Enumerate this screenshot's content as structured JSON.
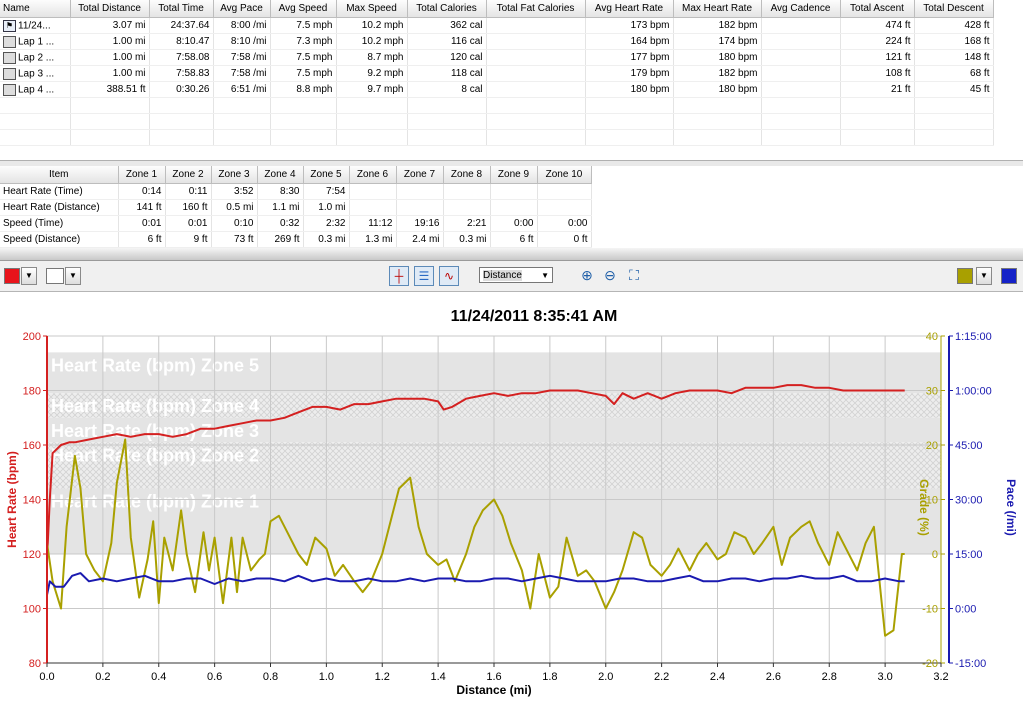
{
  "laps": {
    "columns": [
      "Name",
      "Total Distance",
      "Total Time",
      "Avg Pace",
      "Avg Speed",
      "Max Speed",
      "Total Calories",
      "Total Fat Calories",
      "Avg Heart Rate",
      "Max Heart Rate",
      "Avg Cadence",
      "Total Ascent",
      "Total Descent"
    ],
    "rows": [
      [
        "11/24...",
        "3.07 mi",
        "24:37.64",
        "8:00 /mi",
        "7.5 mph",
        "10.2 mph",
        "362 cal",
        "",
        "173 bpm",
        "182 bpm",
        "",
        "474 ft",
        "428 ft"
      ],
      [
        "Lap 1 ...",
        "1.00 mi",
        "8:10.47",
        "8:10 /mi",
        "7.3 mph",
        "10.2 mph",
        "116 cal",
        "",
        "164 bpm",
        "174 bpm",
        "",
        "224 ft",
        "168 ft"
      ],
      [
        "Lap 2 ...",
        "1.00 mi",
        "7:58.08",
        "7:58 /mi",
        "7.5 mph",
        "8.7 mph",
        "120 cal",
        "",
        "177 bpm",
        "180 bpm",
        "",
        "121 ft",
        "148 ft"
      ],
      [
        "Lap 3 ...",
        "1.00 mi",
        "7:58.83",
        "7:58 /mi",
        "7.5 mph",
        "9.2 mph",
        "118 cal",
        "",
        "179 bpm",
        "182 bpm",
        "",
        "108 ft",
        "68 ft"
      ],
      [
        "Lap 4 ...",
        "388.51 ft",
        "0:30.26",
        "6:51 /mi",
        "8.8 mph",
        "9.7 mph",
        "8 cal",
        "",
        "180 bpm",
        "180 bpm",
        "",
        "21 ft",
        "45 ft"
      ]
    ]
  },
  "zones": {
    "columns": [
      "Item",
      "Zone 1",
      "Zone 2",
      "Zone 3",
      "Zone 4",
      "Zone 5",
      "Zone 6",
      "Zone 7",
      "Zone 8",
      "Zone 9",
      "Zone 10"
    ],
    "rows": [
      [
        "Heart Rate (Time)",
        "0:14",
        "0:11",
        "3:52",
        "8:30",
        "7:54",
        "",
        "",
        "",
        "",
        ""
      ],
      [
        "Heart Rate (Distance)",
        "141 ft",
        "160 ft",
        "0.5 mi",
        "1.1 mi",
        "1.0 mi",
        "",
        "",
        "",
        "",
        ""
      ],
      [
        "Speed (Time)",
        "0:01",
        "0:01",
        "0:10",
        "0:32",
        "2:32",
        "11:12",
        "19:16",
        "2:21",
        "0:00",
        "0:00"
      ],
      [
        "Speed (Distance)",
        "6 ft",
        "9 ft",
        "73 ft",
        "269 ft",
        "0.3 mi",
        "1.3 mi",
        "2.4 mi",
        "0.3 mi",
        "6 ft",
        "0 ft"
      ]
    ]
  },
  "toolbar": {
    "left_color": "#e8141b",
    "left_color2": "#ffffff",
    "right_color": "#a9a000",
    "right_color2": "#1522c8",
    "xaxis_value": "Distance",
    "icons": [
      "chart-crosshair-icon",
      "chart-split-icon",
      "chart-wave-icon",
      "zoom-in-icon",
      "zoom-out-icon",
      "zoom-fit-icon"
    ]
  },
  "chart_data": {
    "type": "line",
    "title": "11/24/2011 8:35:41 AM",
    "xlabel": "Distance (mi)",
    "xlim": [
      0,
      3.2
    ],
    "x_ticks": [
      "0.0",
      "0.2",
      "0.4",
      "0.6",
      "0.8",
      "1.0",
      "1.2",
      "1.4",
      "1.6",
      "1.8",
      "2.0",
      "2.2",
      "2.4",
      "2.6",
      "2.8",
      "3.0",
      "3.2"
    ],
    "axes": {
      "left": {
        "label": "Heart Rate (bpm)",
        "ylim": [
          80,
          200
        ],
        "ticks": [
          "80",
          "100",
          "120",
          "140",
          "160",
          "180",
          "200"
        ],
        "color": "#d42020"
      },
      "right1": {
        "label": "Grade (%)",
        "ylim": [
          -20,
          40
        ],
        "ticks": [
          "-20",
          "-10",
          "0",
          "10",
          "20",
          "30",
          "40"
        ],
        "color": "#a9a000"
      },
      "right2": {
        "label": "Pace (/mi)",
        "ticks": [
          "15:00",
          "0:00",
          "15:00",
          "30:00",
          "45:00",
          "1:00:00",
          "1:15:00"
        ],
        "color": "#1a1ab0"
      }
    },
    "zones": [
      {
        "name": "Heart Rate (bpm) Zone 5",
        "range": [
          179,
          194
        ],
        "style": "solid"
      },
      {
        "name": "Heart Rate (bpm) Zone 4",
        "range": [
          170,
          179
        ],
        "style": "hatch"
      },
      {
        "name": "Heart Rate (bpm) Zone 3",
        "range": [
          161,
          170
        ],
        "style": "solid"
      },
      {
        "name": "Heart Rate (bpm) Zone 2",
        "range": [
          144,
          161
        ],
        "style": "hatch"
      },
      {
        "name": "Heart Rate (bpm) Zone 1",
        "range": [
          120,
          144
        ],
        "style": "solid"
      }
    ],
    "series": [
      {
        "name": "Heart Rate (bpm)",
        "axis": "left",
        "color": "#d42020",
        "x": [
          0,
          0.01,
          0.02,
          0.05,
          0.08,
          0.1,
          0.15,
          0.2,
          0.25,
          0.3,
          0.35,
          0.4,
          0.45,
          0.5,
          0.55,
          0.6,
          0.65,
          0.7,
          0.75,
          0.8,
          0.85,
          0.9,
          0.95,
          1.0,
          1.05,
          1.1,
          1.15,
          1.2,
          1.25,
          1.3,
          1.35,
          1.4,
          1.42,
          1.45,
          1.5,
          1.55,
          1.6,
          1.65,
          1.7,
          1.75,
          1.8,
          1.85,
          1.9,
          1.95,
          2.0,
          2.03,
          2.06,
          2.1,
          2.15,
          2.2,
          2.25,
          2.3,
          2.35,
          2.4,
          2.45,
          2.5,
          2.55,
          2.6,
          2.65,
          2.7,
          2.75,
          2.8,
          2.85,
          2.9,
          2.95,
          3.0,
          3.05,
          3.07
        ],
        "y": [
          118,
          140,
          157,
          160,
          161,
          161,
          162,
          163,
          164,
          163,
          164,
          164,
          163,
          164,
          166,
          166,
          167,
          168,
          169,
          169,
          170,
          172,
          174,
          174,
          173,
          175,
          175,
          176,
          177,
          177,
          177,
          176,
          173,
          174,
          177,
          178,
          179,
          178,
          179,
          179,
          180,
          180,
          180,
          179,
          178,
          175,
          179,
          177,
          179,
          177,
          179,
          180,
          180,
          180,
          179,
          181,
          181,
          181,
          182,
          182,
          181,
          181,
          180,
          180,
          180,
          180,
          180,
          180
        ]
      },
      {
        "name": "Grade (%)",
        "axis": "right1",
        "color": "#a9a000",
        "x": [
          0,
          0.02,
          0.05,
          0.07,
          0.1,
          0.12,
          0.14,
          0.17,
          0.2,
          0.23,
          0.25,
          0.28,
          0.3,
          0.33,
          0.36,
          0.38,
          0.4,
          0.42,
          0.45,
          0.48,
          0.5,
          0.53,
          0.56,
          0.58,
          0.6,
          0.63,
          0.66,
          0.68,
          0.7,
          0.73,
          0.76,
          0.78,
          0.8,
          0.83,
          0.86,
          0.9,
          0.93,
          0.96,
          1.0,
          1.03,
          1.06,
          1.1,
          1.13,
          1.16,
          1.2,
          1.23,
          1.26,
          1.3,
          1.33,
          1.36,
          1.4,
          1.43,
          1.46,
          1.5,
          1.53,
          1.56,
          1.6,
          1.63,
          1.66,
          1.7,
          1.73,
          1.76,
          1.8,
          1.83,
          1.86,
          1.9,
          1.93,
          1.96,
          2.0,
          2.03,
          2.06,
          2.1,
          2.13,
          2.16,
          2.2,
          2.23,
          2.26,
          2.3,
          2.33,
          2.36,
          2.4,
          2.43,
          2.46,
          2.5,
          2.53,
          2.56,
          2.6,
          2.63,
          2.66,
          2.7,
          2.73,
          2.76,
          2.8,
          2.83,
          2.86,
          2.9,
          2.93,
          2.96,
          3.0,
          3.03,
          3.06,
          3.07
        ],
        "y": [
          2,
          -5,
          -10,
          5,
          18,
          12,
          0,
          -3,
          -5,
          2,
          13,
          21,
          3,
          -8,
          -1,
          6,
          -9,
          3,
          -3,
          8,
          0,
          -7,
          4,
          -3,
          3,
          -9,
          3,
          -7,
          3,
          -3,
          -1,
          0,
          6,
          7,
          4,
          0,
          -2,
          3,
          1,
          -4,
          -2,
          -5,
          -7,
          -5,
          0,
          6,
          12,
          14,
          5,
          0,
          -2,
          -1,
          -5,
          0,
          5,
          8,
          10,
          7,
          2,
          -3,
          -10,
          0,
          -8,
          -6,
          3,
          -4,
          -3,
          -5,
          -10,
          -7,
          -3,
          4,
          3,
          -2,
          -4,
          -2,
          1,
          -3,
          0,
          2,
          -1,
          0,
          4,
          3,
          0,
          2,
          5,
          -2,
          3,
          5,
          6,
          2,
          -2,
          4,
          1,
          -3,
          2,
          5,
          -15,
          -14,
          0,
          0
        ]
      },
      {
        "name": "Pace (/mi)",
        "axis": "right2",
        "color": "#1a1ab0",
        "x": [
          0,
          0.01,
          0.03,
          0.06,
          0.09,
          0.12,
          0.15,
          0.2,
          0.25,
          0.3,
          0.35,
          0.4,
          0.45,
          0.5,
          0.55,
          0.6,
          0.65,
          0.7,
          0.75,
          0.8,
          0.85,
          0.9,
          0.95,
          1.0,
          1.05,
          1.1,
          1.15,
          1.2,
          1.25,
          1.3,
          1.35,
          1.4,
          1.45,
          1.5,
          1.55,
          1.6,
          1.65,
          1.7,
          1.75,
          1.8,
          1.85,
          1.9,
          1.95,
          2.0,
          2.05,
          2.1,
          2.15,
          2.2,
          2.25,
          2.3,
          2.35,
          2.4,
          2.45,
          2.5,
          2.55,
          2.6,
          2.65,
          2.7,
          2.75,
          2.8,
          2.85,
          2.9,
          2.95,
          3.0,
          3.05,
          3.07
        ],
        "y": [
          105,
          110,
          108,
          108,
          112,
          113,
          110,
          111,
          110,
          111,
          112,
          110,
          110,
          111,
          111,
          109,
          111,
          110,
          111,
          111,
          110,
          112,
          110,
          111,
          110,
          110,
          111,
          110,
          110,
          111,
          110,
          111,
          111,
          110,
          110,
          111,
          111,
          110,
          111,
          112,
          111,
          110,
          110,
          110,
          111,
          111,
          110,
          110,
          111,
          112,
          110,
          110,
          111,
          111,
          110,
          111,
          111,
          112,
          111,
          111,
          112,
          110,
          110,
          111,
          110,
          110
        ]
      }
    ]
  }
}
